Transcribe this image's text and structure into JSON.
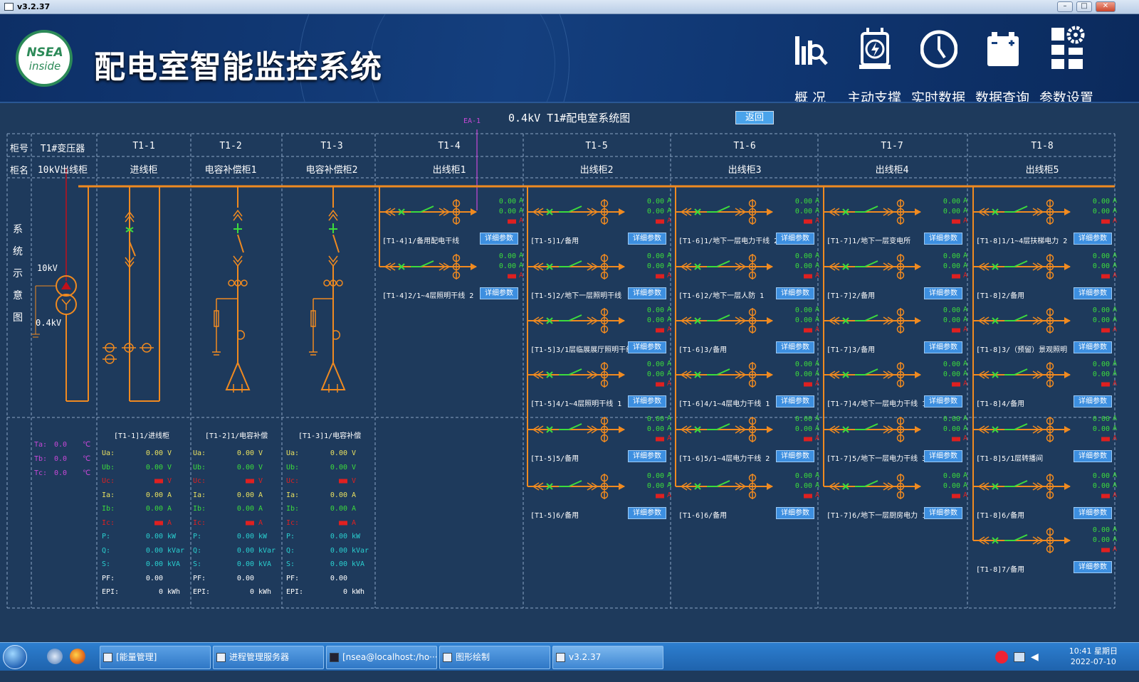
{
  "window": {
    "title": "v3.2.37"
  },
  "header": {
    "logo_line1": "NSEA",
    "logo_line2": "inside",
    "title": "配电室智能监控系统",
    "nav": [
      {
        "label": "概  况",
        "icon": "overview-chart-icon"
      },
      {
        "label": "主动支撑",
        "icon": "power-support-icon"
      },
      {
        "label": "实时数据",
        "icon": "realtime-clock-icon"
      },
      {
        "label": "数据查询",
        "icon": "battery-query-icon"
      },
      {
        "label": "参数设置",
        "icon": "settings-gear-icon"
      }
    ]
  },
  "system": {
    "title": "0.4kV T1#配电室系统图",
    "back_label": "返回",
    "ea_label": "EA-1",
    "row_label_number": "柜号",
    "row_label_name": "柜名",
    "side_label": [
      "系",
      "统",
      "示",
      "意",
      "图"
    ]
  },
  "cabinets": [
    {
      "number": "T1#变压器",
      "name": "10kV出线柜"
    },
    {
      "number": "T1-1",
      "name": "进线柜"
    },
    {
      "number": "T1-2",
      "name": "电容补偿柜1"
    },
    {
      "number": "T1-3",
      "name": "电容补偿柜2"
    },
    {
      "number": "T1-4",
      "name": "出线柜1"
    },
    {
      "number": "T1-5",
      "name": "出线柜2"
    },
    {
      "number": "T1-6",
      "name": "出线柜3"
    },
    {
      "number": "T1-7",
      "name": "出线柜4"
    },
    {
      "number": "T1-8",
      "name": "出线柜5"
    }
  ],
  "transformer": {
    "hv": "10kV",
    "lv": "0.4kV",
    "temps": [
      {
        "label": "Ta:",
        "value": "0.0",
        "unit": "℃"
      },
      {
        "label": "Tb:",
        "value": "0.0",
        "unit": "℃"
      },
      {
        "label": "Tc:",
        "value": "0.0",
        "unit": "℃"
      }
    ]
  },
  "meters": [
    {
      "title": "[T1-1]1/进线柜",
      "rows": [
        [
          "Ua:",
          "0.00",
          "V"
        ],
        [
          "Ub:",
          "0.00",
          "V"
        ],
        [
          "Uc:",
          "■■",
          "V"
        ],
        [
          "Ia:",
          "0.00",
          "A"
        ],
        [
          "Ib:",
          "0.00",
          "A"
        ],
        [
          "Ic:",
          "■■",
          "A"
        ],
        [
          "P:",
          "0.00",
          "kW"
        ],
        [
          "Q:",
          "0.00",
          "kVar"
        ],
        [
          "S:",
          "0.00",
          "kVA"
        ],
        [
          "PF:",
          "0.00",
          ""
        ],
        [
          "EPI:",
          "0",
          "kWh"
        ]
      ]
    },
    {
      "title": "[T1-2]1/电容补偿",
      "rows": [
        [
          "Ua:",
          "0.00",
          "V"
        ],
        [
          "Ub:",
          "0.00",
          "V"
        ],
        [
          "Uc:",
          "■■",
          "V"
        ],
        [
          "Ia:",
          "0.00",
          "A"
        ],
        [
          "Ib:",
          "0.00",
          "A"
        ],
        [
          "Ic:",
          "■■",
          "A"
        ],
        [
          "P:",
          "0.00",
          "kW"
        ],
        [
          "Q:",
          "0.00",
          "kVar"
        ],
        [
          "S:",
          "0.00",
          "kVA"
        ],
        [
          "PF:",
          "0.00",
          ""
        ],
        [
          "EPI:",
          "0",
          "kWh"
        ]
      ]
    },
    {
      "title": "[T1-3]1/电容补偿",
      "rows": [
        [
          "Ua:",
          "0.00",
          "V"
        ],
        [
          "Ub:",
          "0.00",
          "V"
        ],
        [
          "Uc:",
          "■■",
          "V"
        ],
        [
          "Ia:",
          "0.00",
          "A"
        ],
        [
          "Ib:",
          "0.00",
          "A"
        ],
        [
          "Ic:",
          "■■",
          "A"
        ],
        [
          "P:",
          "0.00",
          "kW"
        ],
        [
          "Q:",
          "0.00",
          "kVar"
        ],
        [
          "S:",
          "0.00",
          "kVA"
        ],
        [
          "PF:",
          "0.00",
          ""
        ],
        [
          "EPI:",
          "0",
          "kWh"
        ]
      ]
    }
  ],
  "feeder_common": {
    "detail_label": "详细参数",
    "ia": "0.00",
    "ib": "0.00",
    "ic": "■■",
    "unit": "A"
  },
  "feeders": [
    [
      "[T1-4]1/备用配电干线",
      "[T1-4]2/1~4层照明干线 2"
    ],
    [
      "[T1-5]1/备用",
      "[T1-5]2/地下一层照明干线",
      "[T1-5]3/1层临展展厅照明干线",
      "[T1-5]4/1~4层照明干线 1",
      "[T1-5]5/备用",
      "[T1-5]6/备用"
    ],
    [
      "[T1-6]1/地下一层电力干线 2",
      "[T1-6]2/地下一层人防 1",
      "[T1-6]3/备用",
      "[T1-6]4/1~4层电力干线 1",
      "[T1-6]5/1~4层电力干线 2",
      "[T1-6]6/备用"
    ],
    [
      "[T1-7]1/地下一层变电所",
      "[T1-7]2/备用",
      "[T1-7]3/备用",
      "[T1-7]4/地下一层电力干线 1",
      "[T1-7]5/地下一层电力干线 3",
      "[T1-7]6/地下一层厨房电力 1"
    ],
    [
      "[T1-8]1/1~4层扶梯电力 2",
      "[T1-8]2/备用",
      "[T1-8]3/（预留）景观照明",
      "[T1-8]4/备用",
      "[T1-8]5/1层转播间",
      "[T1-8]6/备用",
      "[T1-8]7/备用"
    ]
  ],
  "taskbar": {
    "items": [
      {
        "label": "[能量管理]"
      },
      {
        "label": "进程管理服务器"
      },
      {
        "label": "[nsea@localhost:/ho···"
      },
      {
        "label": "图形绘制"
      },
      {
        "label": "v3.2.37"
      }
    ],
    "time": "10:41 星期日",
    "date": "2022-07-10"
  }
}
